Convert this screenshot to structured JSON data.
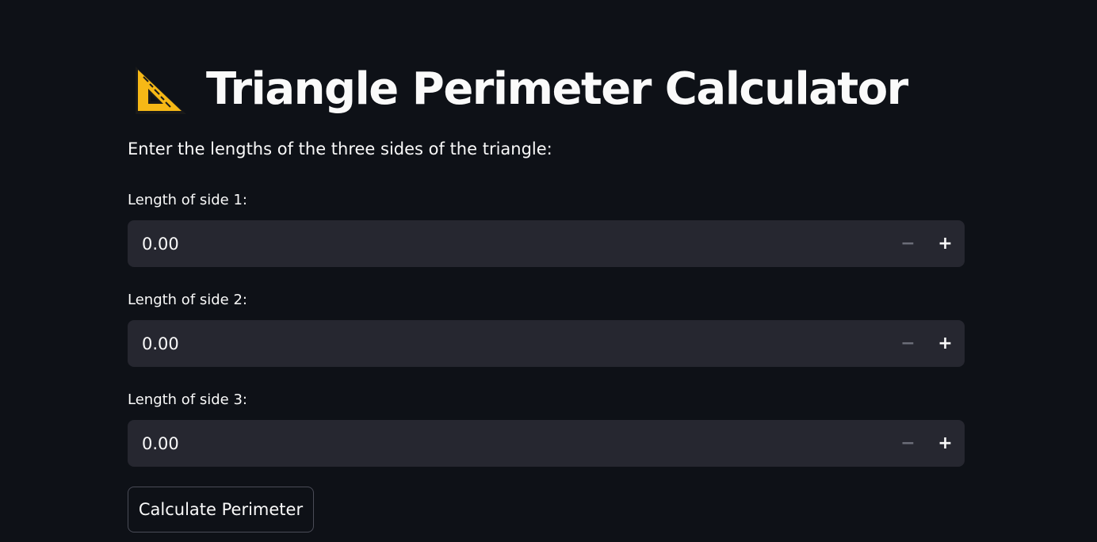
{
  "page": {
    "title": "Triangle Perimeter Calculator",
    "title_icon": "triangular-ruler-icon",
    "instructions": "Enter the lengths of the three sides of the triangle:"
  },
  "inputs": [
    {
      "label": "Length of side 1:",
      "value": "0.00",
      "minus": "−",
      "plus": "+"
    },
    {
      "label": "Length of side 2:",
      "value": "0.00",
      "minus": "−",
      "plus": "+"
    },
    {
      "label": "Length of side 3:",
      "value": "0.00",
      "minus": "−",
      "plus": "+"
    }
  ],
  "actions": {
    "calculate_label": "Calculate Perimeter"
  },
  "colors": {
    "background": "#0e1117",
    "input_background": "#262730",
    "text": "#fafafa",
    "ruler_yellow": "#f6b816"
  }
}
